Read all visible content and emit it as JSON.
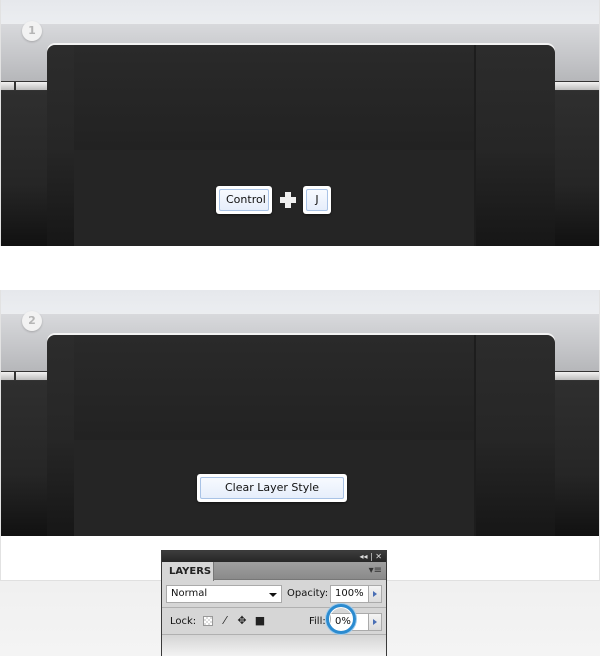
{
  "steps": [
    {
      "number": "1",
      "shortcut": {
        "keys": [
          "Control",
          "J"
        ],
        "separator_icon": "plus-icon"
      }
    },
    {
      "number": "2",
      "button": {
        "label": "Clear Layer Style"
      }
    }
  ],
  "layers_panel": {
    "title_controls": "◂◂ | ✕",
    "tab_label": "LAYERS",
    "menu_icon": "▾≡",
    "blend_mode": "Normal",
    "opacity_label": "Opacity:",
    "opacity_value": "100%",
    "lock_label": "Lock:",
    "fill_label": "Fill:",
    "fill_value": "0%",
    "highlight_color": "#2b8bd0"
  }
}
